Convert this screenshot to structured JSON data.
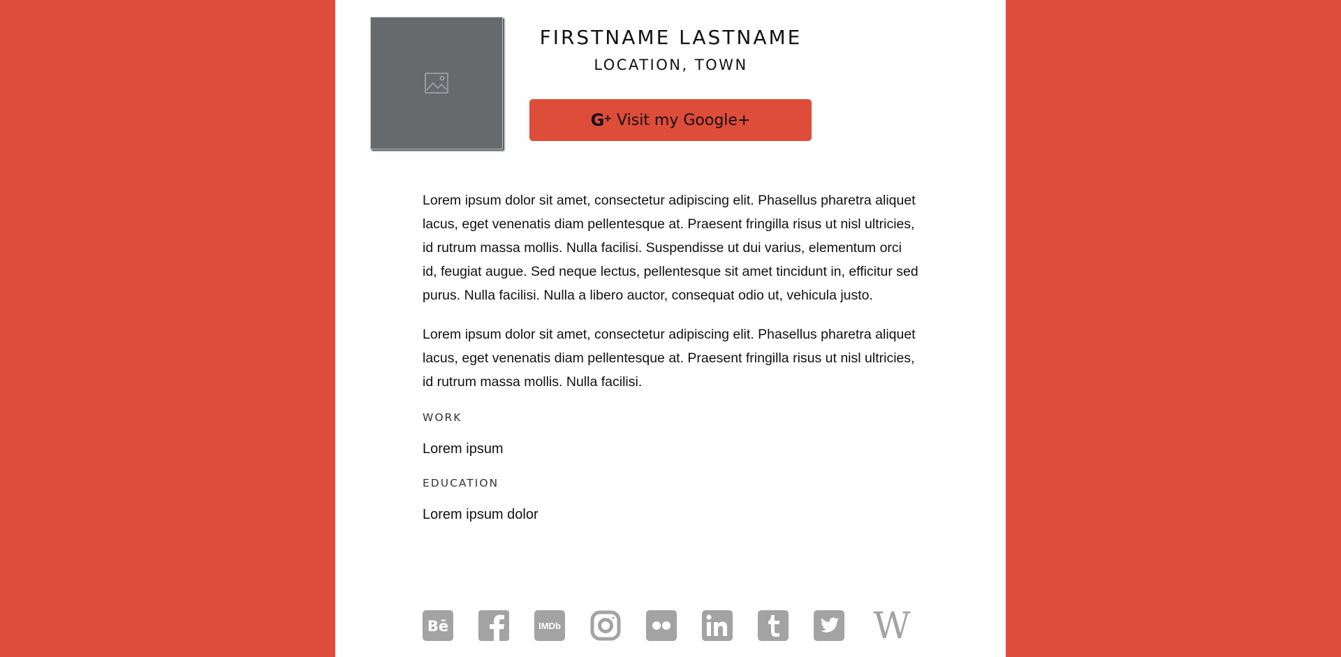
{
  "profile": {
    "name": "FIRSTNAME LASTNAME",
    "location": "LOCATION, TOWN",
    "gplus_button_label": "Visit my Google+",
    "gplus_icon": "google-plus-icon",
    "photo_icon": "image-placeholder-icon"
  },
  "bio": {
    "paragraphs": [
      "Lorem ipsum dolor sit amet, consectetur adipiscing elit. Phasellus pharetra aliquet lacus, eget venenatis diam pellentesque at. Praesent fringilla risus ut nisl ultricies, id rutrum massa mollis. Nulla facilisi. Suspendisse ut dui varius, elementum orci id, feugiat augue. Sed neque lectus, pellentesque sit amet tincidunt in, efficitur sed purus. Nulla facilisi. Nulla a libero auctor, consequat odio ut, vehicula justo.",
      "Lorem ipsum dolor sit amet, consectetur adipiscing elit. Phasellus pharetra aliquet lacus, eget venenatis diam pellentesque at. Praesent fringilla risus ut nisl ultricies, id rutrum massa mollis. Nulla facilisi."
    ]
  },
  "work": {
    "label": "WORK",
    "value": "Lorem ipsum"
  },
  "education": {
    "label": "EDUCATION",
    "value": "Lorem ipsum dolor"
  },
  "social_links": [
    {
      "icon": "behance-icon"
    },
    {
      "icon": "facebook-icon"
    },
    {
      "icon": "imdb-icon"
    },
    {
      "icon": "instagram-icon"
    },
    {
      "icon": "flickr-icon"
    },
    {
      "icon": "linkedin-icon"
    },
    {
      "icon": "tumblr-icon"
    },
    {
      "icon": "twitter-icon"
    },
    {
      "icon": "wikipedia-icon"
    }
  ],
  "colors": {
    "background": "#de4c3a",
    "card": "#ffffff",
    "accent": "#de4c3a",
    "photo_placeholder": "#666a6d",
    "social_icon": "#a3a3a3"
  }
}
